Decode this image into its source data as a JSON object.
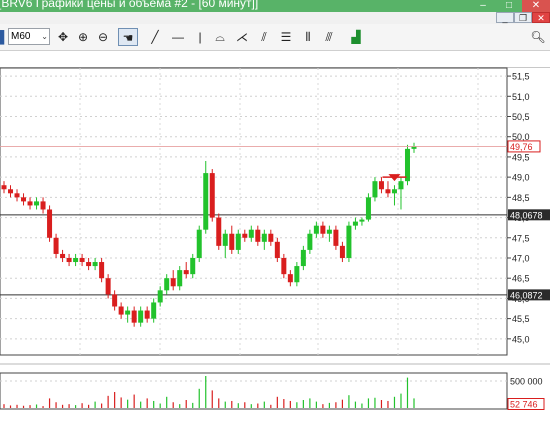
{
  "window": {
    "title": "[BRV6 Графики цены и объема #2 - [60 минут]]",
    "minimize_glyph": "–",
    "maximize_glyph": "□",
    "close_glyph": "✕"
  },
  "mdi": {
    "minimize_glyph": "_",
    "restore_glyph": "❐",
    "close_glyph": "✕"
  },
  "toolbar": {
    "timeframe": "M60",
    "icons": [
      "crosshair-icon",
      "zoom-in-icon",
      "zoom-out-icon",
      "hand-icon",
      "trend-line-icon",
      "horizontal-line-icon",
      "vertical-line-icon",
      "arc-icon",
      "fan-icon",
      "channel-icon",
      "levels-icon",
      "cycles-icon",
      "parallel-lines-icon",
      "indicator-icon",
      "search-icon"
    ]
  },
  "colors": {
    "up": "#22c22c",
    "down": "#d91e1e",
    "axis_text": "#222222",
    "level_line": "#333333",
    "current_price": "#d91e1e"
  },
  "chart_data": {
    "type": "candlestick",
    "price_axis": {
      "ylim": [
        44.6,
        51.7
      ],
      "tick_labels": [
        "51,5",
        "51,0",
        "50,5",
        "50,0",
        "49,5",
        "49,0",
        "48,5",
        "48,0",
        "47,5",
        "47,0",
        "46,5",
        "46,0",
        "45,5",
        "45,0"
      ]
    },
    "current_price_label": "49,76",
    "level_labels": [
      "48,0678",
      "46,0872"
    ],
    "levels": [
      48.0678,
      46.0872
    ],
    "grid": true,
    "candles": [
      [
        48.8,
        48.9,
        48.6,
        48.7
      ],
      [
        48.7,
        48.8,
        48.5,
        48.6
      ],
      [
        48.6,
        48.7,
        48.4,
        48.5
      ],
      [
        48.5,
        48.6,
        48.3,
        48.4
      ],
      [
        48.4,
        48.5,
        48.2,
        48.3
      ],
      [
        48.3,
        48.5,
        48.2,
        48.4
      ],
      [
        48.4,
        48.5,
        48.1,
        48.2
      ],
      [
        48.2,
        48.3,
        47.4,
        47.5
      ],
      [
        47.5,
        47.6,
        47.0,
        47.1
      ],
      [
        47.1,
        47.2,
        46.9,
        47.0
      ],
      [
        47.0,
        47.1,
        46.8,
        46.9
      ],
      [
        46.9,
        47.1,
        46.8,
        47.0
      ],
      [
        47.0,
        47.1,
        46.8,
        46.9
      ],
      [
        46.9,
        47.0,
        46.7,
        46.8
      ],
      [
        46.8,
        47.0,
        46.7,
        46.9
      ],
      [
        46.9,
        47.0,
        46.4,
        46.5
      ],
      [
        46.5,
        46.6,
        46.0,
        46.1
      ],
      [
        46.1,
        46.2,
        45.7,
        45.8
      ],
      [
        45.8,
        45.9,
        45.5,
        45.6
      ],
      [
        45.6,
        45.8,
        45.4,
        45.7
      ],
      [
        45.7,
        45.8,
        45.3,
        45.4
      ],
      [
        45.4,
        45.8,
        45.3,
        45.7
      ],
      [
        45.7,
        45.8,
        45.4,
        45.5
      ],
      [
        45.5,
        46.0,
        45.4,
        45.9
      ],
      [
        45.9,
        46.3,
        45.8,
        46.2
      ],
      [
        46.2,
        46.6,
        46.1,
        46.5
      ],
      [
        46.5,
        46.7,
        46.2,
        46.3
      ],
      [
        46.3,
        46.8,
        46.2,
        46.7
      ],
      [
        46.7,
        46.9,
        46.5,
        46.6
      ],
      [
        46.6,
        47.1,
        46.5,
        47.0
      ],
      [
        47.0,
        47.8,
        46.9,
        47.7
      ],
      [
        47.7,
        49.4,
        47.6,
        49.1
      ],
      [
        49.1,
        49.2,
        47.9,
        48.0
      ],
      [
        48.0,
        48.1,
        47.2,
        47.3
      ],
      [
        47.3,
        47.7,
        47.0,
        47.6
      ],
      [
        47.6,
        47.8,
        47.1,
        47.2
      ],
      [
        47.2,
        47.7,
        47.1,
        47.6
      ],
      [
        47.6,
        47.7,
        47.4,
        47.5
      ],
      [
        47.5,
        47.8,
        47.4,
        47.7
      ],
      [
        47.7,
        47.8,
        47.3,
        47.4
      ],
      [
        47.4,
        47.7,
        47.2,
        47.6
      ],
      [
        47.6,
        47.7,
        47.3,
        47.4
      ],
      [
        47.4,
        47.5,
        46.9,
        47.0
      ],
      [
        47.0,
        47.1,
        46.5,
        46.6
      ],
      [
        46.6,
        46.7,
        46.3,
        46.4
      ],
      [
        46.4,
        46.9,
        46.3,
        46.8
      ],
      [
        46.8,
        47.3,
        46.7,
        47.2
      ],
      [
        47.2,
        47.7,
        47.1,
        47.6
      ],
      [
        47.6,
        47.9,
        47.5,
        47.8
      ],
      [
        47.8,
        47.9,
        47.5,
        47.6
      ],
      [
        47.6,
        47.8,
        47.4,
        47.7
      ],
      [
        47.7,
        47.8,
        47.2,
        47.3
      ],
      [
        47.3,
        47.4,
        46.9,
        47.0
      ],
      [
        47.0,
        47.9,
        46.9,
        47.8
      ],
      [
        47.8,
        48.0,
        47.7,
        47.9
      ],
      [
        47.9,
        48.0,
        47.8,
        47.95
      ],
      [
        47.95,
        48.6,
        47.9,
        48.5
      ],
      [
        48.5,
        49.0,
        48.4,
        48.9
      ],
      [
        48.9,
        49.0,
        48.6,
        48.7
      ],
      [
        48.7,
        48.9,
        48.5,
        48.6
      ],
      [
        48.6,
        48.8,
        48.3,
        48.7
      ],
      [
        48.7,
        49.0,
        48.2,
        48.9
      ],
      [
        48.9,
        49.8,
        48.8,
        49.7
      ],
      [
        49.7,
        49.85,
        49.6,
        49.76
      ]
    ],
    "marker": {
      "type": "sell-arrow",
      "price": 49.0
    },
    "volume_axis": {
      "tick_label": "500 000",
      "current_label": "52 746"
    },
    "volumes": [
      0.12,
      0.08,
      0.1,
      0.07,
      0.09,
      0.11,
      0.06,
      0.3,
      0.18,
      0.1,
      0.12,
      0.09,
      0.15,
      0.1,
      0.2,
      0.14,
      0.38,
      0.5,
      0.33,
      0.26,
      0.42,
      0.2,
      0.3,
      0.22,
      0.14,
      0.35,
      0.18,
      0.12,
      0.25,
      0.16,
      0.6,
      1.0,
      0.55,
      0.3,
      0.2,
      0.22,
      0.15,
      0.18,
      0.12,
      0.14,
      0.2,
      0.1,
      0.35,
      0.28,
      0.22,
      0.18,
      0.25,
      0.3,
      0.2,
      0.12,
      0.16,
      0.18,
      0.26,
      0.4,
      0.2,
      0.14,
      0.3,
      0.32,
      0.25,
      0.22,
      0.35,
      0.45,
      0.95,
      0.3
    ]
  }
}
